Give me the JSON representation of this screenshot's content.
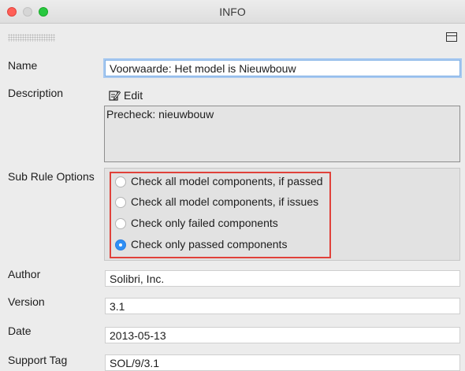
{
  "window": {
    "title": "INFO"
  },
  "form": {
    "name": {
      "label": "Name",
      "value": "Voorwaarde: Het model is Nieuwbouw"
    },
    "description": {
      "label": "Description",
      "edit_label": "Edit",
      "text": "Precheck: nieuwbouw"
    },
    "sub_rule_options": {
      "label": "Sub Rule Options",
      "options": [
        {
          "label": "Check all model components, if passed",
          "selected": false
        },
        {
          "label": "Check all model components, if issues",
          "selected": false
        },
        {
          "label": "Check only failed components",
          "selected": false
        },
        {
          "label": "Check only passed components",
          "selected": true
        }
      ]
    },
    "author": {
      "label": "Author",
      "value": "Solibri, Inc."
    },
    "version": {
      "label": "Version",
      "value": "3.1"
    },
    "date": {
      "label": "Date",
      "value": "2013-05-13"
    },
    "support_tag": {
      "label": "Support Tag",
      "value": "SOL/9/3.1"
    }
  },
  "colors": {
    "accent": "#2f8ff5",
    "highlight_border": "#e0413a",
    "close": "#ff5f57",
    "maximize": "#28c840"
  }
}
